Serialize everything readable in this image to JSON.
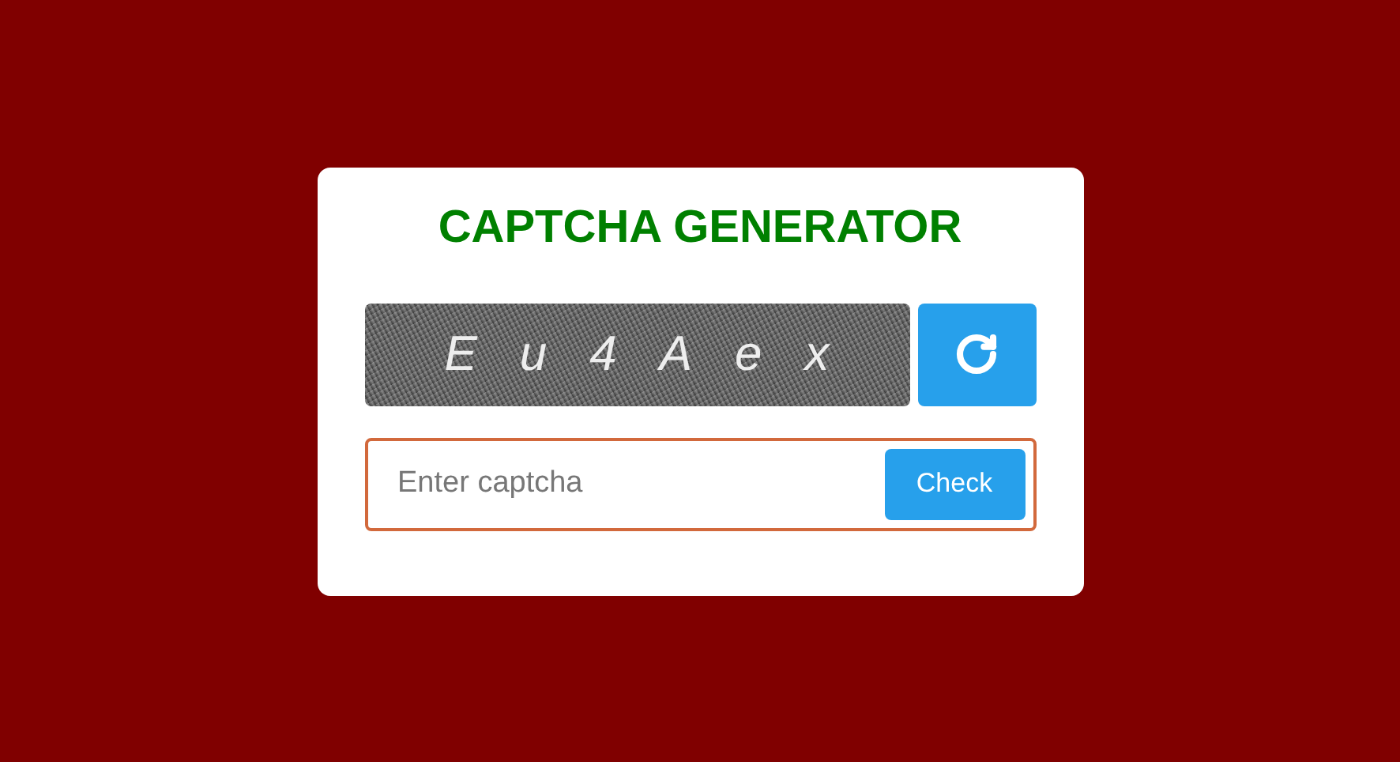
{
  "title": "CAPTCHA GENERATOR",
  "captcha": {
    "text": "Eu4Aex"
  },
  "answer": {
    "placeholder": "Enter captcha"
  },
  "check_button": {
    "label": "Check"
  }
}
